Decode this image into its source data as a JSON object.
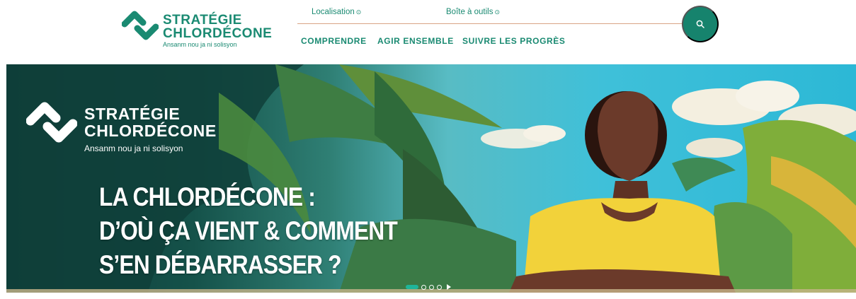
{
  "brand": {
    "line1": "STRATÉGIE",
    "line2": "CHLORDÉCONE",
    "tagline": "Ansanm nou ja ni solisyon",
    "color": "#1a8a72"
  },
  "topnav": {
    "items": [
      {
        "label": "Localisation",
        "icon": "chevron-down-circle-icon"
      },
      {
        "label": "Boîte à outils",
        "icon": "chevron-down-circle-icon"
      }
    ]
  },
  "mainnav": {
    "items": [
      {
        "label": "COMPRENDRE"
      },
      {
        "label": "AGIR ENSEMBLE"
      },
      {
        "label": "SUIVRE LES PROGRÈS"
      }
    ]
  },
  "search": {
    "icon": "search-icon",
    "color": "#16836d"
  },
  "hero": {
    "brand_line1": "STRATÉGIE",
    "brand_line2": "CHLORDÉCONE",
    "brand_tagline": "Ansanm nou ja ni solisyon",
    "headline": [
      "LA CHLORDÉCONE :",
      "D’OÙ ÇA VIENT & COMMENT",
      "S’EN DÉBARRASSER ?"
    ],
    "carousel": {
      "slides": 4,
      "active": 1,
      "control_icon": "play-icon"
    }
  }
}
